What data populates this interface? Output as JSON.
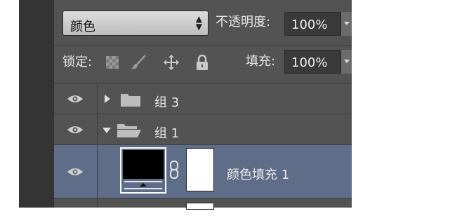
{
  "options_bar": {
    "blend_mode": "颜色",
    "opacity_label": "不透明度:",
    "opacity_value": "100%",
    "lock_label": "锁定:",
    "fill_label": "填充:",
    "fill_value": "100%"
  },
  "lock_icons": [
    "lock-transparent-pixels-icon",
    "lock-image-pixels-icon",
    "lock-position-icon",
    "lock-all-icon"
  ],
  "layers": [
    {
      "name": "组 3",
      "type": "group",
      "expanded": false,
      "visible": true,
      "selected": false
    },
    {
      "name": "组 1",
      "type": "group",
      "expanded": true,
      "visible": true,
      "selected": false
    },
    {
      "name": "颜色填充 1",
      "type": "fill-layer",
      "visible": true,
      "selected": true
    }
  ],
  "colors": {
    "panel_bg": "#535353",
    "selected_row": "#5f6e88",
    "dark_strip": "#343434"
  }
}
